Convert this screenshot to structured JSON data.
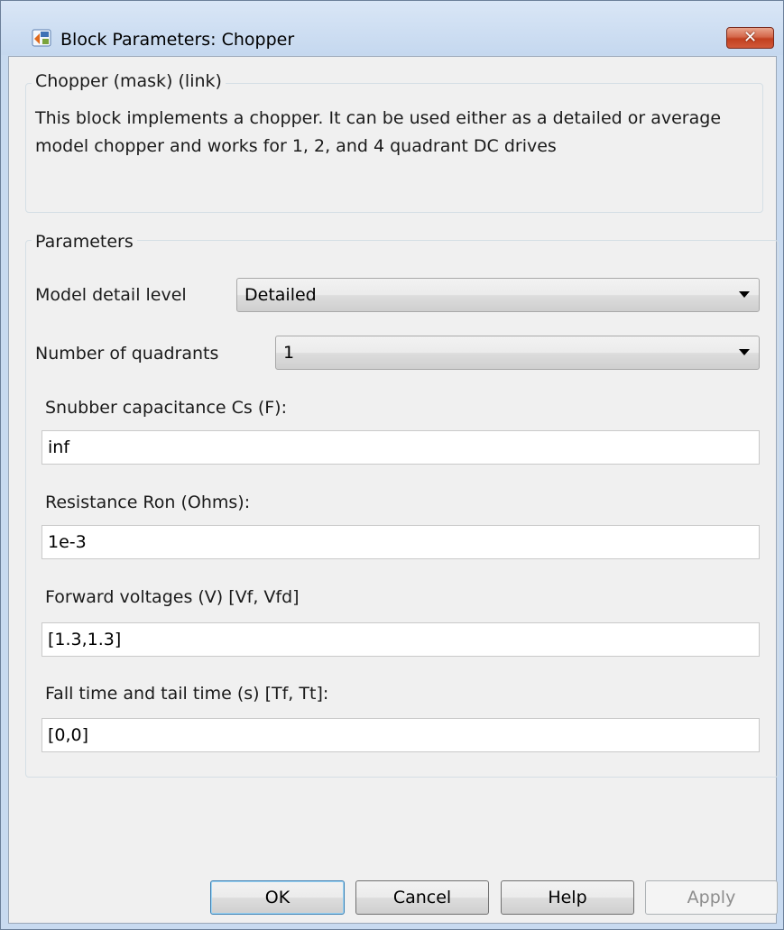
{
  "window": {
    "title": "Block Parameters: Chopper",
    "close_glyph": "✕"
  },
  "mask_group": {
    "legend": "Chopper (mask) (link)",
    "description": "This block implements a chopper. It can be used either as a detailed or average model chopper and works for 1, 2, and 4 quadrant DC drives"
  },
  "parameters": {
    "legend": "Parameters",
    "model_detail_level": {
      "label": "Model detail level",
      "value": "Detailed"
    },
    "number_of_quadrants": {
      "label": "Number of quadrants",
      "value": "1"
    },
    "snubber_capacitance": {
      "label": "Snubber capacitance Cs (F):",
      "value": "inf"
    },
    "resistance_ron": {
      "label": "Resistance Ron (Ohms):",
      "value": "1e-3"
    },
    "forward_voltages": {
      "label": "Forward voltages (V) [Vf, Vfd]",
      "value": "[1.3,1.3]"
    },
    "fall_tail_time": {
      "label": "Fall time and tail time (s) [Tf, Tt]:",
      "value": "[0,0]"
    }
  },
  "buttons": {
    "ok": "OK",
    "cancel": "Cancel",
    "help": "Help",
    "apply": "Apply"
  },
  "icons": {
    "app_icon": "simulink-block-icon",
    "close_icon": "close-icon",
    "dropdown_icon": "chevron-down-icon"
  },
  "colors": {
    "title_bar": "#c5d8ef",
    "close_button": "#c2401f",
    "client_background": "#f0f0f0",
    "default_button_border": "#3c7fb1"
  }
}
